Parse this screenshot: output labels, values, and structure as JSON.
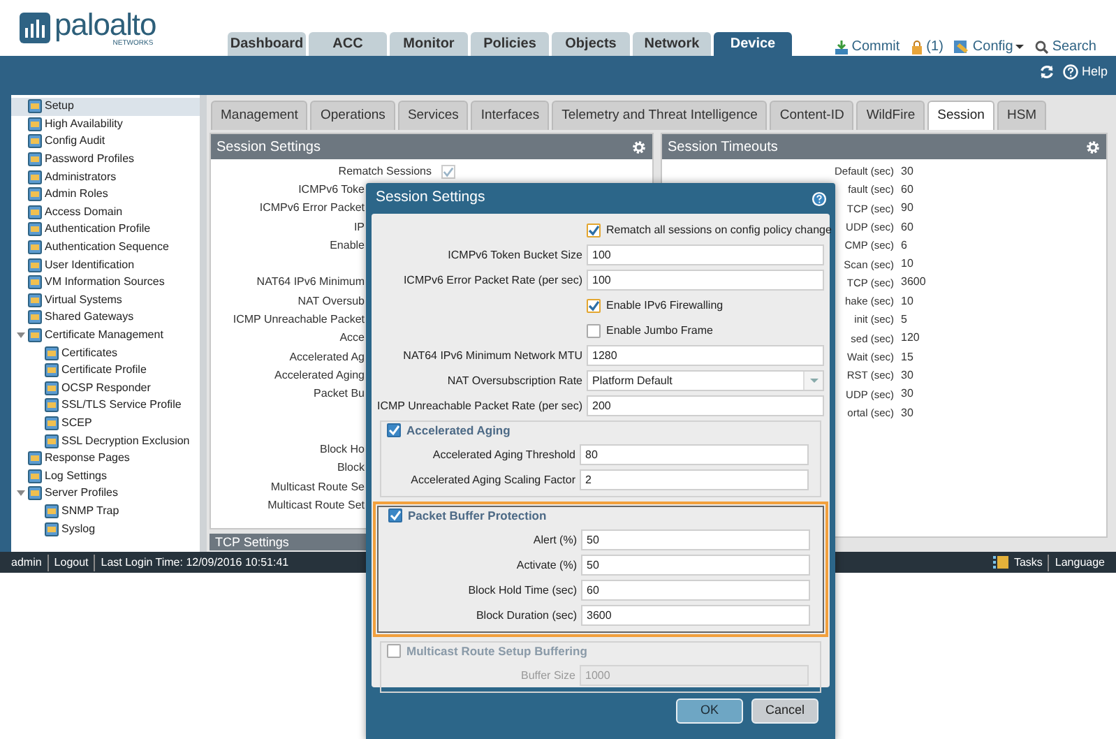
{
  "header": {
    "logo": {
      "name": "paloalto",
      "sub": "NETWORKS"
    },
    "tabs": [
      {
        "label": "Dashboard",
        "selected": false
      },
      {
        "label": "ACC",
        "selected": false
      },
      {
        "label": "Monitor",
        "selected": false
      },
      {
        "label": "Policies",
        "selected": false
      },
      {
        "label": "Objects",
        "selected": false
      },
      {
        "label": "Network",
        "selected": false
      },
      {
        "label": "Device",
        "selected": true
      }
    ],
    "actions": [
      {
        "kind": "commit",
        "label": "Commit"
      },
      {
        "kind": "lock",
        "label": "(1)"
      },
      {
        "kind": "config",
        "label": "Config"
      },
      {
        "kind": "search",
        "label": "Search"
      }
    ]
  },
  "toolbar": {
    "help": "Help"
  },
  "sidebar": {
    "items": [
      {
        "label": "Setup",
        "selected": true
      },
      {
        "label": "High Availability",
        "selected": false
      },
      {
        "label": "Config Audit",
        "selected": false
      },
      {
        "label": "Password Profiles",
        "selected": false
      },
      {
        "label": "Administrators",
        "selected": false
      },
      {
        "label": "Admin Roles",
        "selected": false
      },
      {
        "label": "Access Domain",
        "selected": false
      },
      {
        "label": "Authentication Profile",
        "selected": false
      },
      {
        "label": "Authentication Sequence",
        "selected": false
      },
      {
        "label": "User Identification",
        "selected": false
      },
      {
        "label": "VM Information Sources",
        "selected": false
      },
      {
        "label": "Virtual Systems",
        "selected": false
      },
      {
        "label": "Shared Gateways",
        "selected": false
      },
      {
        "label": "Certificate Management",
        "selected": false,
        "expanded": true,
        "children": [
          {
            "label": "Certificates",
            "selected": false
          },
          {
            "label": "Certificate Profile",
            "selected": false
          },
          {
            "label": "OCSP Responder",
            "selected": false
          },
          {
            "label": "SSL/TLS Service Profile",
            "selected": false
          },
          {
            "label": "SCEP",
            "selected": false
          },
          {
            "label": "SSL Decryption Exclusion",
            "selected": false
          }
        ]
      },
      {
        "label": "Response Pages",
        "selected": false
      },
      {
        "label": "Log Settings",
        "selected": false
      },
      {
        "label": "Server Profiles",
        "selected": false,
        "expanded": true,
        "children": [
          {
            "label": "SNMP Trap",
            "selected": false
          },
          {
            "label": "Syslog",
            "selected": false
          }
        ]
      }
    ]
  },
  "subtabs": [
    {
      "label": "Management",
      "selected": false
    },
    {
      "label": "Operations",
      "selected": false
    },
    {
      "label": "Services",
      "selected": false
    },
    {
      "label": "Interfaces",
      "selected": false
    },
    {
      "label": "Telemetry and Threat Intelligence",
      "selected": false
    },
    {
      "label": "Content-ID",
      "selected": false
    },
    {
      "label": "WildFire",
      "selected": false
    },
    {
      "label": "Session",
      "selected": true
    },
    {
      "label": "HSM",
      "selected": false
    }
  ],
  "session_settings_panel": {
    "title": "Session Settings",
    "groups": [
      [
        {
          "kind": "checkbox",
          "label": "Rematch Sessions",
          "checked": true
        },
        {
          "kind": "label",
          "label": "ICMPv6 Toke"
        },
        {
          "kind": "label",
          "label": "ICMPv6 Error Packet"
        },
        {
          "kind": "label",
          "label": "IP"
        },
        {
          "kind": "label",
          "label": "Enable"
        }
      ],
      [
        {
          "kind": "label",
          "label": "NAT64 IPv6 Minimum"
        },
        {
          "kind": "label",
          "label": "NAT Oversub"
        },
        {
          "kind": "label",
          "label": "ICMP Unreachable Packet"
        },
        {
          "kind": "label",
          "label": "Acce"
        },
        {
          "kind": "label",
          "label": "Accelerated Ag"
        },
        {
          "kind": "label",
          "label": "Accelerated Aging"
        },
        {
          "kind": "label",
          "label": "Packet Bu"
        }
      ],
      [
        {
          "kind": "label",
          "label": "Block Ho"
        },
        {
          "kind": "label",
          "label": "Block"
        },
        {
          "kind": "label",
          "label": "Multicast Route Se"
        },
        {
          "kind": "label",
          "label": "Multicast Route Set"
        }
      ]
    ]
  },
  "session_timeouts_panel": {
    "title": "Session Timeouts",
    "rows": [
      {
        "label": "Default (sec)",
        "value": "30"
      },
      {
        "label": "fault (sec)",
        "value": "60"
      },
      {
        "label": "TCP (sec)",
        "value": "90"
      },
      {
        "label": "UDP (sec)",
        "value": "60"
      },
      {
        "label": "CMP (sec)",
        "value": "6"
      },
      {
        "label": "Scan (sec)",
        "value": "10"
      },
      {
        "label": "TCP (sec)",
        "value": "3600"
      },
      {
        "label": "hake (sec)",
        "value": "10"
      },
      {
        "label": "init (sec)",
        "value": "5"
      },
      {
        "label": "sed (sec)",
        "value": "120"
      },
      {
        "label": "Wait (sec)",
        "value": "15"
      },
      {
        "label": "RST (sec)",
        "value": "30"
      },
      {
        "label": "UDP (sec)",
        "value": "30"
      },
      {
        "label": "ortal (sec)",
        "value": "30"
      }
    ]
  },
  "tcp_settings_panel": {
    "title": "TCP Settings"
  },
  "status_bar": {
    "user": "admin",
    "logout": "Logout",
    "last_login": "Last Login Time: 12/09/2016 10:51:41",
    "tasks": "Tasks",
    "language": "Language"
  },
  "dialog": {
    "title": "Session Settings",
    "rows": [
      {
        "kind": "checkbox",
        "label": "Rematch all sessions on config policy change",
        "checked": true
      },
      {
        "kind": "field",
        "label": "ICMPv6 Token Bucket Size",
        "value": "100"
      },
      {
        "kind": "field",
        "label": "ICMPv6 Error Packet Rate (per sec)",
        "value": "100"
      },
      {
        "kind": "checkbox",
        "label": "Enable IPv6 Firewalling",
        "checked": true
      },
      {
        "kind": "checkbox",
        "label": "Enable Jumbo Frame",
        "checked": false
      },
      {
        "kind": "field",
        "label": "NAT64 IPv6 Minimum Network MTU",
        "value": "1280"
      },
      {
        "kind": "select",
        "label": "NAT Oversubscription Rate",
        "value": "Platform Default"
      },
      {
        "kind": "field",
        "label": "ICMP Unreachable Packet Rate (per sec)",
        "value": "200"
      }
    ],
    "groups": [
      {
        "title": "Accelerated Aging",
        "checked": true,
        "highlighted": false,
        "fields": [
          {
            "label": "Accelerated Aging Threshold",
            "value": "80"
          },
          {
            "label": "Accelerated Aging Scaling Factor",
            "value": "2"
          }
        ]
      },
      {
        "title": "Packet Buffer Protection",
        "checked": true,
        "highlighted": true,
        "fields": [
          {
            "label": "Alert (%)",
            "value": "50"
          },
          {
            "label": "Activate (%)",
            "value": "50"
          },
          {
            "label": "Block Hold Time (sec)",
            "value": "60"
          },
          {
            "label": "Block Duration (sec)",
            "value": "3600"
          }
        ]
      },
      {
        "title": "Multicast Route Setup Buffering",
        "checked": false,
        "highlighted": false,
        "fields": [
          {
            "label": "Buffer Size",
            "value": "1000"
          }
        ]
      }
    ],
    "buttons": [
      {
        "label": "OK",
        "kind": "primary"
      },
      {
        "label": "Cancel",
        "kind": "secondary"
      }
    ]
  }
}
